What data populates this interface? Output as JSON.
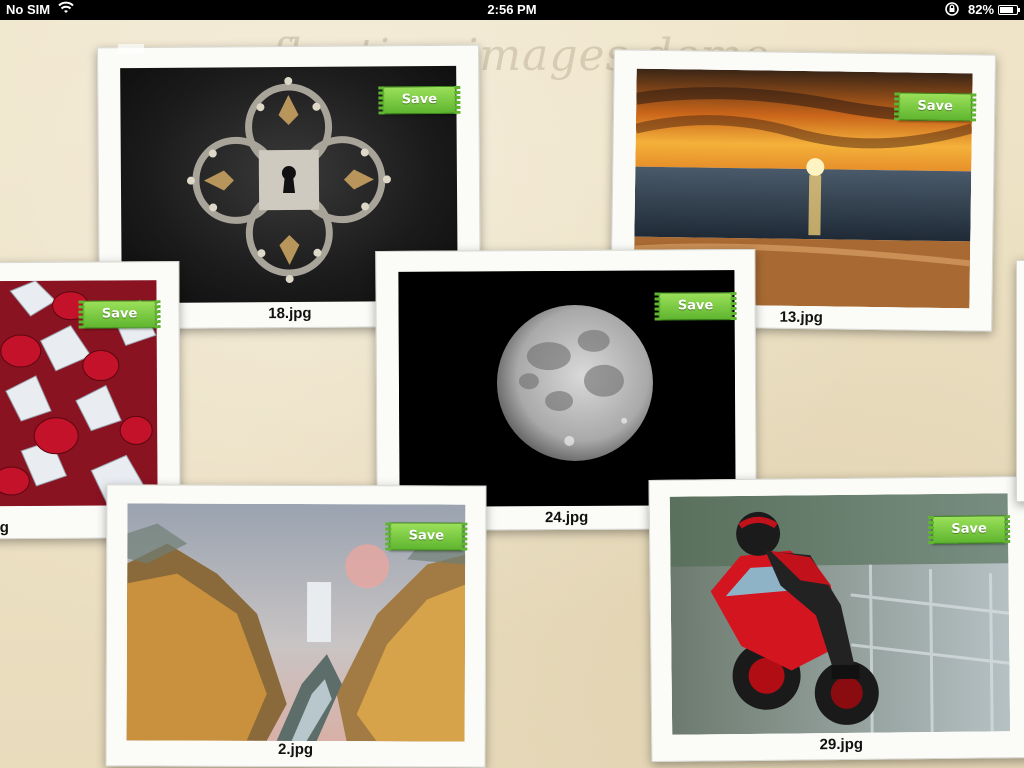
{
  "status_bar": {
    "carrier": "No SIM",
    "time": "2:56 PM",
    "battery": "82%",
    "battery_level": 0.82
  },
  "board": {
    "title": "floating images demo"
  },
  "cards": [
    {
      "id": "card-18",
      "caption": "18.jpg",
      "save_label": "Save",
      "subject": "ornate-keyhole-lock"
    },
    {
      "id": "card-13",
      "caption": "13.jpg",
      "save_label": "Save",
      "subject": "ocean-sunset"
    },
    {
      "id": "card-gems",
      "caption": "g",
      "save_label": "Save",
      "subject": "rubies-and-diamonds"
    },
    {
      "id": "card-24",
      "caption": "24.jpg",
      "save_label": "Save",
      "subject": "moon"
    },
    {
      "id": "card-2",
      "caption": "2.jpg",
      "save_label": "Save",
      "subject": "canyon-waterfall"
    },
    {
      "id": "card-29",
      "caption": "29.jpg",
      "save_label": "Save",
      "subject": "red-motorcycle-rider"
    }
  ],
  "colors": {
    "save_green": "#5fb52f",
    "paper": "#efe4c8"
  }
}
